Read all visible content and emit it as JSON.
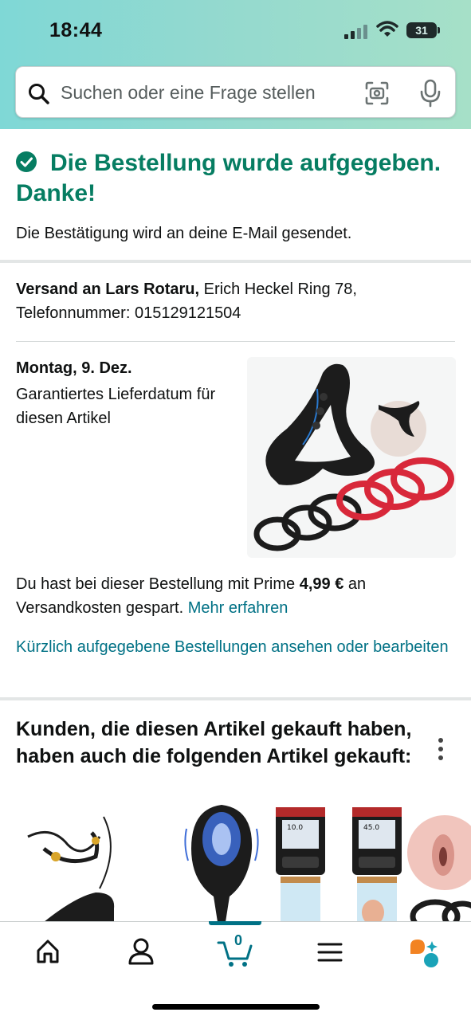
{
  "status_bar": {
    "time": "18:44",
    "battery": "31"
  },
  "search": {
    "placeholder": "Suchen oder eine Frage stellen"
  },
  "confirmation": {
    "title": "Die Bestellung wurde aufgegeben. Danke!",
    "subtitle": "Die Bestätigung wird an deine E-Mail gesendet."
  },
  "shipping": {
    "label": "Versand an Lars Rotaru,",
    "address": " Erich Heckel Ring 78,",
    "phone": "Telefonnummer: 015129121504"
  },
  "delivery": {
    "date": "Montag, 9. Dez.",
    "note": "Garantiertes Lieferdatum für diesen Artikel"
  },
  "prime": {
    "text_before": "Du hast bei dieser Bestellung mit Prime ",
    "amount": "4,99 €",
    "text_after": " an Versandkosten gespart. ",
    "link": "Mehr erfahren"
  },
  "recent_orders_link": "Kürzlich aufgegebene Bestellungen ansehen oder bearbeiten",
  "recommendations": {
    "title": "Kunden, die diesen Artikel gekauft haben, haben auch die folgenden Artikel gekauft:",
    "device_readouts": [
      "10.0",
      "45.0"
    ]
  },
  "bottom_nav": {
    "cart_count": "0",
    "accent_color": "#007185"
  },
  "colors": {
    "success": "#067d62",
    "link": "#007185"
  }
}
